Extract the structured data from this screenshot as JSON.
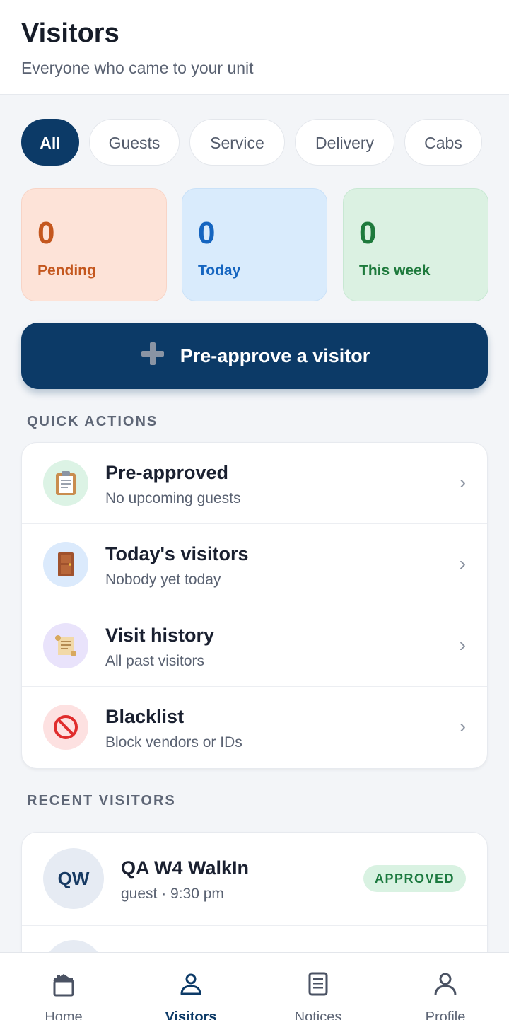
{
  "header": {
    "title": "Visitors",
    "subtitle": "Everyone who came to your unit"
  },
  "filters": [
    {
      "label": "All",
      "active": true
    },
    {
      "label": "Guests",
      "active": false
    },
    {
      "label": "Service",
      "active": false
    },
    {
      "label": "Delivery",
      "active": false
    },
    {
      "label": "Cabs",
      "active": false
    }
  ],
  "stats": {
    "pending": {
      "value": "0",
      "label": "Pending"
    },
    "today": {
      "value": "0",
      "label": "Today"
    },
    "week": {
      "value": "0",
      "label": "This week"
    }
  },
  "cta": {
    "icon": "plus-icon",
    "label": "Pre-approve a visitor"
  },
  "quick_actions": {
    "heading": "QUICK ACTIONS",
    "items": [
      {
        "title": "Pre-approved",
        "subtitle": "No upcoming guests",
        "icon": "clipboard-icon",
        "emoji": "📋",
        "bg": "#dcf3e5"
      },
      {
        "title": "Today's visitors",
        "subtitle": "Nobody yet today",
        "icon": "door-icon",
        "emoji": "🚪",
        "bg": "#dbeafc"
      },
      {
        "title": "Visit history",
        "subtitle": "All past visitors",
        "icon": "scroll-icon",
        "emoji": "📜",
        "bg": "#e9e3fb"
      },
      {
        "title": "Blacklist",
        "subtitle": "Block vendors or IDs",
        "icon": "prohibited-icon",
        "emoji": "🚫",
        "bg": "#fde1e1"
      }
    ]
  },
  "recent_visitors": {
    "heading": "RECENT VISITORS",
    "items": [
      {
        "initials": "QW",
        "name": "QA W4 WalkIn",
        "meta": "guest · 9:30 pm",
        "status": "APPROVED"
      }
    ]
  },
  "bottom_nav": [
    {
      "label": "Home",
      "icon": "home-icon",
      "active": false
    },
    {
      "label": "Visitors",
      "icon": "visitors-icon",
      "active": true
    },
    {
      "label": "Notices",
      "icon": "notices-icon",
      "active": false
    },
    {
      "label": "Profile",
      "icon": "profile-icon",
      "active": false
    }
  ],
  "colors": {
    "primary": "#0c3a67",
    "background": "#f3f5f8"
  }
}
